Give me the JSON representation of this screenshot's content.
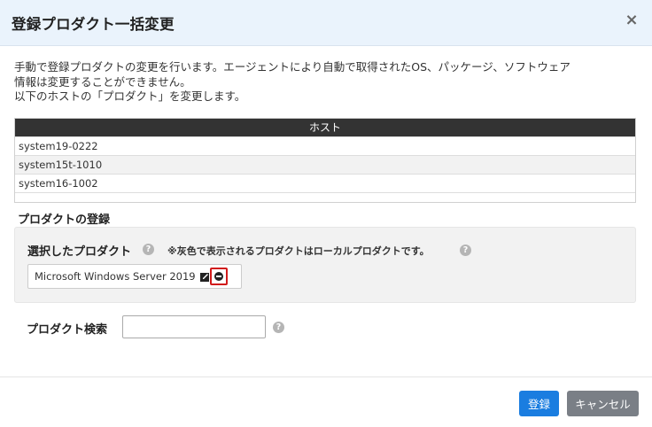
{
  "dialog": {
    "title": "登録プロダクト一括変更",
    "close_label": "×"
  },
  "description": {
    "line1": "手動で登録プロダクトの変更を行います。エージェントにより自動で取得されたOS、パッケージ、ソフトウェア",
    "line2": "情報は変更することができません。",
    "line3": "以下のホストの「プロダクト」を変更します。"
  },
  "host_table": {
    "header": "ホスト",
    "rows": [
      "system19-0222",
      "system15t-1010",
      "system16-1002"
    ]
  },
  "product_registration": {
    "section_title": "プロダクトの登録",
    "selected_label": "選択したプロダクト",
    "note": "※灰色で表示されるプロダクトはローカルプロダクトです。",
    "help_icon": "question-circle-icon",
    "selected_products": [
      {
        "name": "Microsoft Windows Server 2019",
        "edit_icon": "edit-icon",
        "remove_icon": "minus-circle-icon"
      }
    ]
  },
  "search": {
    "label": "プロダクト検索",
    "value": "",
    "placeholder": ""
  },
  "footer": {
    "register_label": "登録",
    "cancel_label": "キャンセル"
  },
  "colors": {
    "header_bg": "#eaf3fc",
    "primary": "#1a7de0",
    "secondary": "#7a7f86",
    "table_header": "#333333",
    "highlight": "#d11a1a"
  }
}
